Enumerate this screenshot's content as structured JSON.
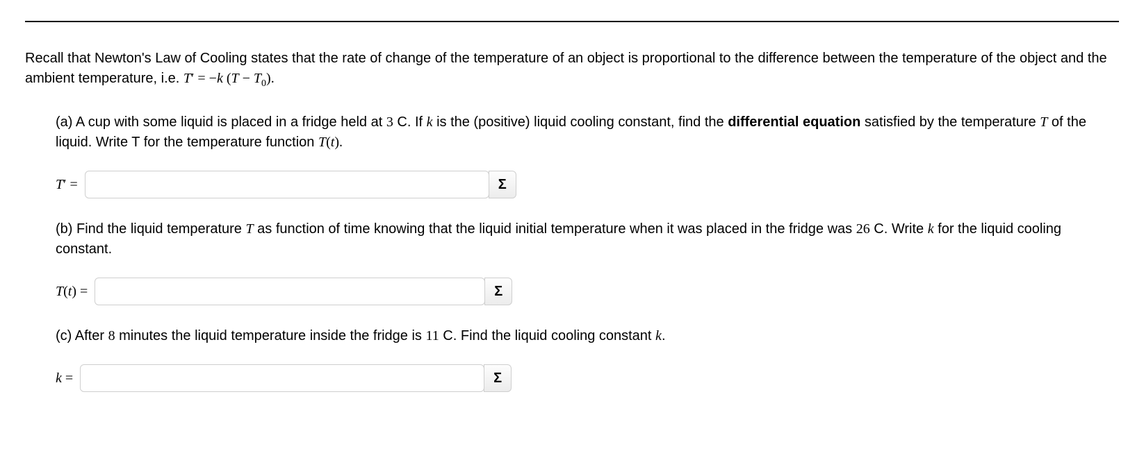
{
  "intro": {
    "t1": "Recall that Newton's Law of Cooling states that the rate of change of the temperature of an object is proportional to the difference between the temperature of the object and the ambient temperature, i.e. ",
    "eq_T": "T",
    "eq_prime": "′",
    "eq_mid": " = −",
    "eq_k": "k",
    "eq_open": " (",
    "eq_T2": "T",
    "eq_minus": " − ",
    "eq_T0": "T",
    "eq_sub0": "0",
    "eq_close": ").",
    "ambient_temp": "3",
    "initial_temp": "26",
    "later_minutes": "8",
    "later_temp": "11"
  },
  "partA": {
    "lead": "(a) A cup with some liquid is placed in a fridge held at ",
    "afterTemp": " C. If ",
    "k": "k",
    "mid": " is the (positive) liquid cooling constant, find the ",
    "bold": "differential equation",
    "mid2": " satisfied by the temperature ",
    "Tvar": "T",
    "mid3": " of the liquid. Write T for the temperature function ",
    "Tfun": "T",
    "paren_t": "(",
    "tvar": "t",
    "paren_close": ").",
    "label_T": "T",
    "label_prime": "′",
    "label_eq": " = ",
    "sigma": "Σ",
    "value": ""
  },
  "partB": {
    "lead": "(b) Find the liquid temperature ",
    "Tvar": "T",
    "mid1": " as function of time knowing that the liquid initial temperature when it was placed in the fridge was ",
    "mid2": " C. Write ",
    "k": "k",
    "mid3": " for the liquid cooling constant.",
    "label_T": "T",
    "paren_t": "(",
    "tvar": "t",
    "paren_close": ")",
    "label_eq": " = ",
    "sigma": "Σ",
    "value": ""
  },
  "partC": {
    "lead": "(c) After ",
    "mid1": " minutes the liquid temperature inside the fridge is ",
    "mid2": " C. Find the liquid cooling constant ",
    "k": "k",
    "period": ".",
    "label_k": "k",
    "label_eq": " = ",
    "sigma": "Σ",
    "value": ""
  }
}
